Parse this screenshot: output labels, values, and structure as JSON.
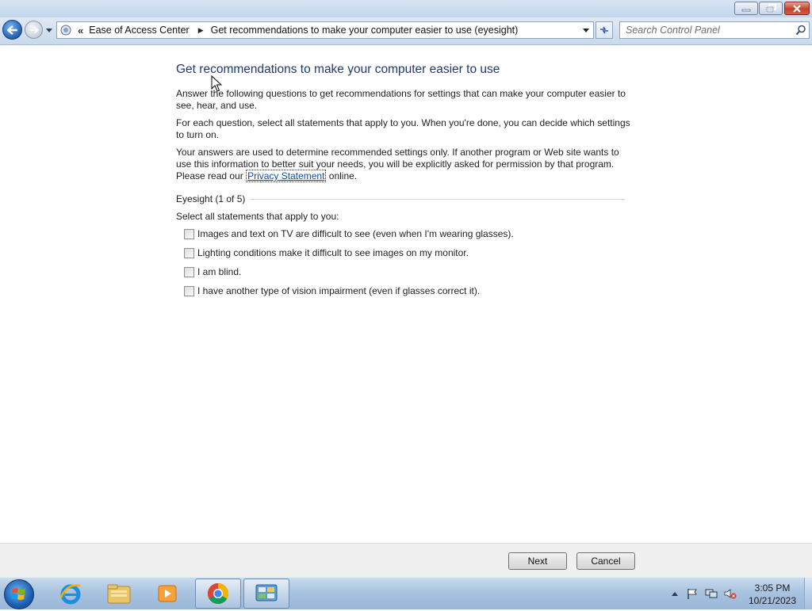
{
  "address_bar": {
    "chevrons": "«",
    "crumbs": [
      "Ease of Access Center",
      "Get recommendations to make your computer easier to use (eyesight)"
    ]
  },
  "search": {
    "placeholder": "Search Control Panel"
  },
  "content": {
    "title": "Get recommendations to make your computer easier to use",
    "para1": "Answer the following questions to get recommendations for settings that can make your computer easier to see, hear, and use.",
    "para2": "For each question, select all statements that apply to you.  When you're done, you can decide which settings to turn on.",
    "para3_before": "Your answers are used to determine recommended settings only. If another program or Web site wants to use this information to better suit your needs, you will be explicitly asked for permission by that program. Please read our ",
    "para3_link": "Privacy Statement",
    "para3_after": " online.",
    "section": "Eyesight (1 of 5)",
    "instruction": "Select all statements that apply to you:",
    "options": [
      "Images and text on TV are difficult to see (even when I'm wearing glasses).",
      "Lighting conditions make it difficult to see images on my monitor.",
      "I am blind.",
      "I have another type of vision impairment (even if glasses correct it)."
    ]
  },
  "footer": {
    "next_label": "Next",
    "cancel_label": "Cancel"
  },
  "taskbar": {
    "pinned": [
      "internet-explorer-icon",
      "windows-explorer-icon",
      "media-player-icon",
      "chrome-icon",
      "control-panel-icon"
    ],
    "active_item": "control-panel-icon"
  },
  "clock": {
    "time": "3:05 PM",
    "date": "10/21/2023"
  }
}
